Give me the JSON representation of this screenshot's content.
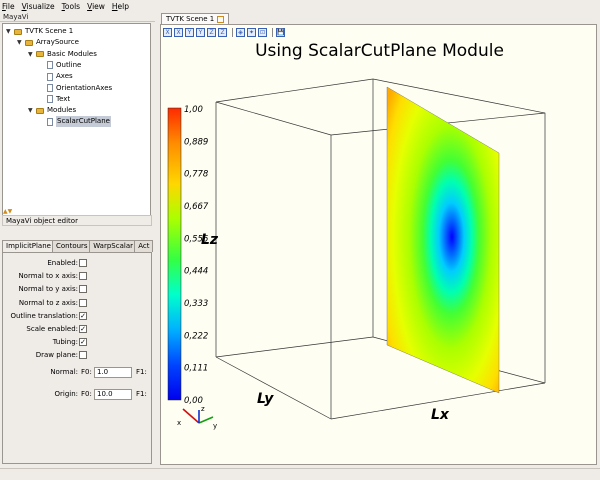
{
  "menubar": {
    "items": [
      {
        "accel": "F",
        "rest": "ile"
      },
      {
        "accel": "V",
        "rest": "isualize"
      },
      {
        "accel": "T",
        "rest": "ools"
      },
      {
        "accel": "V",
        "rest": "iew"
      },
      {
        "accel": "H",
        "rest": "elp"
      }
    ]
  },
  "pipeline": {
    "dock_title": "MayaVi",
    "tree": [
      {
        "label": "TVTK Scene 1",
        "kind": "folder",
        "level": 0,
        "expanded": true
      },
      {
        "label": "ArraySource",
        "kind": "folder",
        "level": 1,
        "expanded": true
      },
      {
        "label": "Basic Modules",
        "kind": "folder",
        "level": 2,
        "expanded": true
      },
      {
        "label": "Outline",
        "kind": "doc",
        "level": 3
      },
      {
        "label": "Axes",
        "kind": "doc",
        "level": 3
      },
      {
        "label": "OrientationAxes",
        "kind": "doc",
        "level": 3
      },
      {
        "label": "Text",
        "kind": "doc",
        "level": 3
      },
      {
        "label": "Modules",
        "kind": "folder",
        "level": 2,
        "expanded": true
      },
      {
        "label": "ScalarCutPlane",
        "kind": "doc",
        "level": 3,
        "selected": true
      }
    ]
  },
  "editor": {
    "title": "MayaVi object editor",
    "tabs": [
      "ImplicitPlane",
      "Contours",
      "WarpScalar",
      "Act"
    ],
    "active_tab": "ImplicitPlane",
    "checkboxes": [
      {
        "label": "Enabled:",
        "checked": false
      },
      {
        "label": "Normal to x axis:",
        "checked": false
      },
      {
        "label": "Normal to y axis:",
        "checked": false
      },
      {
        "label": "Normal to z axis:",
        "checked": false
      },
      {
        "label": "Outline translation:",
        "checked": true
      },
      {
        "label": "Scale enabled:",
        "checked": true
      },
      {
        "label": "Tubing:",
        "checked": true
      },
      {
        "label": "Draw plane:",
        "checked": false
      }
    ],
    "normal": {
      "label": "Normal:",
      "f0_label": "F0:",
      "f0_value": "1.0",
      "f1_label": "F1:"
    },
    "origin": {
      "label": "Origin:",
      "f0_label": "F0:",
      "f0_value": "10.0",
      "f1_label": "F1:"
    }
  },
  "scene": {
    "tab_label": "TVTK Scene 1",
    "toolbar_icons": [
      "view-x-plus-icon",
      "view-x-minus-icon",
      "view-y-plus-icon",
      "view-y-minus-icon",
      "view-z-plus-icon",
      "view-z-minus-icon",
      "isometric-icon",
      "parallel-projection-icon",
      "fullscreen-icon",
      "save-icon"
    ],
    "toolbar_glyphs": [
      "X",
      "X",
      "Y",
      "Y",
      "Z",
      "Z",
      "◈",
      "✦",
      "⊡",
      "💾"
    ],
    "title": "Using ScalarCutPlane Module",
    "colorbar": {
      "labels": [
        "1,00",
        "0,889",
        "0,778",
        "0,667",
        "0,556",
        "0,444",
        "0,333",
        "0,222",
        "0,111",
        "0,00"
      ],
      "colors_top_to_bottom": [
        "#ff2a00",
        "#ff8c00",
        "#ffd700",
        "#aaff00",
        "#33ff44",
        "#00ffcc",
        "#00b0ff",
        "#0044ff",
        "#0000ee"
      ]
    },
    "axes": {
      "x": "Lx",
      "y": "Ly",
      "z": "Lz"
    },
    "orientation_axes": {
      "x": "x",
      "y": "y",
      "z": "z"
    }
  }
}
